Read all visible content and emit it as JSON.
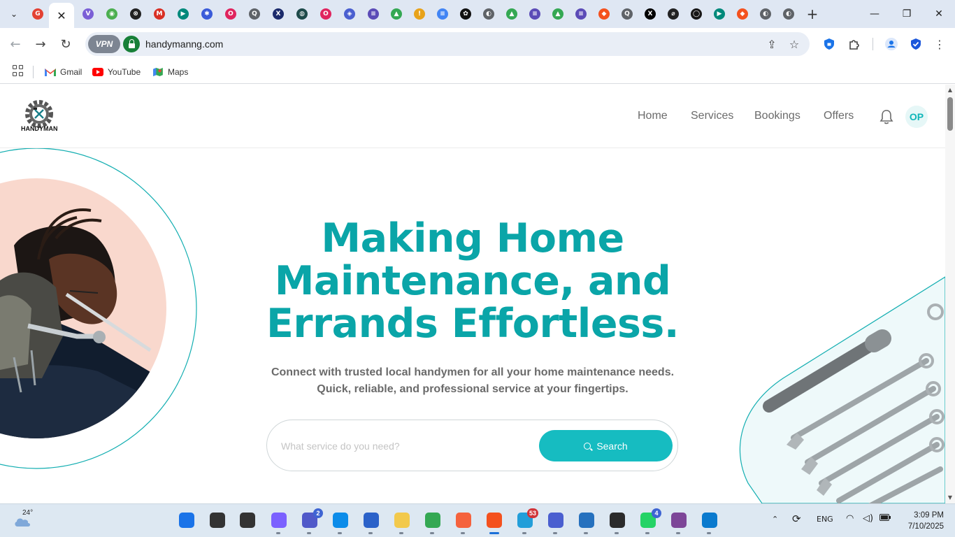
{
  "browser": {
    "tabs": [
      {
        "icon": "gmail-tab-icon",
        "color": "#e34133",
        "glyph": "G"
      },
      {
        "icon": "close-tab-icon",
        "active": true,
        "glyph": "✕"
      },
      {
        "icon": "vivaldi-tab-icon",
        "color": "#7b5fd6",
        "glyph": "V"
      },
      {
        "icon": "chrome-tab-icon",
        "color": "#4caf50",
        "glyph": "◉"
      },
      {
        "icon": "settings-tab-icon",
        "color": "#222222",
        "glyph": "⊗"
      },
      {
        "icon": "gmail-m-tab-icon",
        "color": "#d93025",
        "glyph": "M"
      },
      {
        "icon": "meet-tab-icon",
        "color": "#00897b",
        "glyph": "▶"
      },
      {
        "icon": "asterisk-tab-icon",
        "color": "#3a5bd9",
        "glyph": "✱"
      },
      {
        "icon": "opera-tab-icon",
        "color": "#e0245e",
        "glyph": "O"
      },
      {
        "icon": "lens-tab-icon",
        "color": "#5f6368",
        "glyph": "Q"
      },
      {
        "icon": "x-circle-tab-icon",
        "color": "#1b2a6b",
        "glyph": "X"
      },
      {
        "icon": "chatgpt-tab-icon",
        "color": "#1e4a4a",
        "glyph": "◍"
      },
      {
        "icon": "opera-tab-icon-2",
        "color": "#e0245e",
        "glyph": "O"
      },
      {
        "icon": "gemini-tab-icon",
        "color": "#4a5fd0",
        "glyph": "◈"
      },
      {
        "icon": "list-tab-icon",
        "color": "#5b4bb7",
        "glyph": "≡"
      },
      {
        "icon": "drive-tab-icon",
        "color": "#34a853",
        "glyph": "▲"
      },
      {
        "icon": "info-tab-icon",
        "color": "#e8a31b",
        "glyph": "!"
      },
      {
        "icon": "docs-tab-icon",
        "color": "#4285f4",
        "glyph": "≡"
      },
      {
        "icon": "openai-tab-icon",
        "color": "#111111",
        "glyph": "✿"
      },
      {
        "icon": "globe-tab-icon",
        "color": "#5f6368",
        "glyph": "◐"
      },
      {
        "icon": "drive-tab-icon-2",
        "color": "#34a853",
        "glyph": "▲"
      },
      {
        "icon": "list-tab-icon-2",
        "color": "#5b4bb7",
        "glyph": "≡"
      },
      {
        "icon": "drive-tab-icon-3",
        "color": "#34a853",
        "glyph": "▲"
      },
      {
        "icon": "list-tab-icon-3",
        "color": "#5b4bb7",
        "glyph": "≡"
      },
      {
        "icon": "brave-tab-icon",
        "color": "#f4511e",
        "glyph": "◆"
      },
      {
        "icon": "lens-tab-icon-2",
        "color": "#5f6368",
        "glyph": "Q"
      },
      {
        "icon": "x-tab-icon",
        "color": "#000000",
        "glyph": "X"
      },
      {
        "icon": "no-sign-tab-icon",
        "color": "#222222",
        "glyph": "⌀"
      },
      {
        "icon": "github-tab-icon",
        "color": "#181717",
        "glyph": "◯"
      },
      {
        "icon": "meet-tab-icon-2",
        "color": "#00897b",
        "glyph": "▶"
      },
      {
        "icon": "brave-tab-icon-2",
        "color": "#f4511e",
        "glyph": "◆"
      },
      {
        "icon": "globe-tab-icon-2",
        "color": "#5f6368",
        "glyph": "◐"
      },
      {
        "icon": "globe-tab-icon-3",
        "color": "#5f6368",
        "glyph": "◐"
      }
    ],
    "new_tab": "+",
    "url": "handymanng.com",
    "vpn_label": "VPN",
    "bookmarks": [
      {
        "label": "Gmail",
        "icon": "gmail-icon"
      },
      {
        "label": "YouTube",
        "icon": "youtube-icon"
      },
      {
        "label": "Maps",
        "icon": "maps-icon"
      }
    ]
  },
  "site": {
    "logo_text": "HANDYMAN",
    "nav": [
      "Home",
      "Services",
      "Bookings",
      "Offers"
    ],
    "avatar_initials": "OP",
    "hero": {
      "title": "Making Home Maintenance, and Errands Effortless.",
      "subtitle_line1": "Connect with trusted local handymen for all your home maintenance needs.",
      "subtitle_line2": "Quick, reliable, and professional service at your fingertips."
    },
    "search": {
      "placeholder": "What service do you need?",
      "button_label": "Search"
    },
    "colors": {
      "accent": "#0aa5a8",
      "button": "#16bcc1"
    }
  },
  "taskbar": {
    "weather_temp": "24°",
    "apps": [
      {
        "name": "start",
        "color": "#1a73e8"
      },
      {
        "name": "search",
        "color": "#333333"
      },
      {
        "name": "task-view",
        "color": "#333333"
      },
      {
        "name": "copilot",
        "color": "#7b61ff"
      },
      {
        "name": "teams",
        "color": "#5059c9",
        "badge": "2",
        "badge_color": "blue"
      },
      {
        "name": "edge",
        "color": "#0c8ce9"
      },
      {
        "name": "store",
        "color": "#2b62c9"
      },
      {
        "name": "file-explorer",
        "color": "#f2c94c"
      },
      {
        "name": "chrome",
        "color": "#34a853"
      },
      {
        "name": "app-orange",
        "color": "#f5623d"
      },
      {
        "name": "brave-active",
        "color": "#f4511e",
        "active": true
      },
      {
        "name": "telegram",
        "color": "#229ed9",
        "badge": "53"
      },
      {
        "name": "proton",
        "color": "#4a5fd0"
      },
      {
        "name": "powershell",
        "color": "#2671be"
      },
      {
        "name": "terminal",
        "color": "#2b2b2b"
      },
      {
        "name": "whatsapp",
        "color": "#25d366",
        "badge": "4",
        "badge_color": "blue"
      },
      {
        "name": "tor",
        "color": "#7d4698"
      },
      {
        "name": "vscode",
        "color": "#0a7ace"
      }
    ],
    "lang": "ENG",
    "time": "3:09 PM",
    "date": "7/10/2025"
  }
}
